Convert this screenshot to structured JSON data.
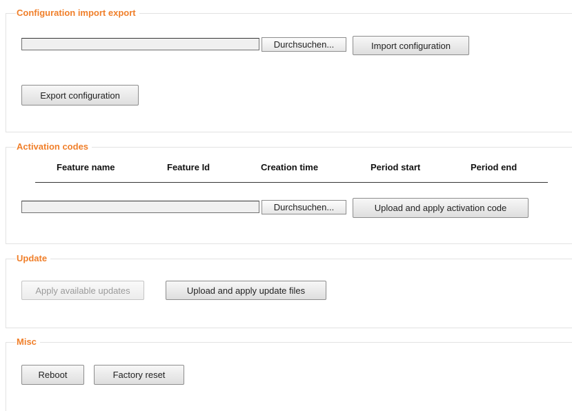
{
  "sections": {
    "config": {
      "title": "Configuration import export",
      "browse_label": "Durchsuchen...",
      "import_label": "Import configuration",
      "export_label": "Export configuration",
      "file_value": ""
    },
    "activation": {
      "title": "Activation codes",
      "columns": [
        "Feature name",
        "Feature Id",
        "Creation time",
        "Period start",
        "Period end"
      ],
      "rows": [],
      "browse_label": "Durchsuchen...",
      "upload_label": "Upload and apply activation code",
      "file_value": ""
    },
    "update": {
      "title": "Update",
      "apply_available_label": "Apply available updates",
      "upload_label": "Upload and apply update files"
    },
    "misc": {
      "title": "Misc",
      "reboot_label": "Reboot",
      "factory_reset_label": "Factory reset"
    }
  },
  "colors": {
    "accent": "#f07f2a",
    "disabled_text": "#9a9a9a"
  }
}
